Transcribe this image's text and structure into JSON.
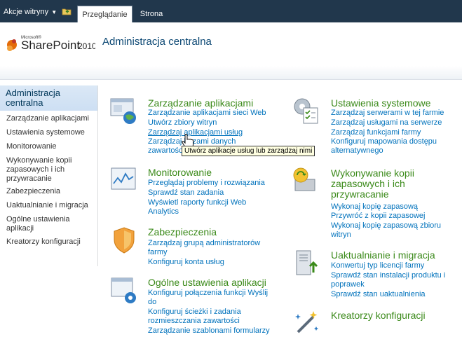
{
  "ribbon": {
    "site_actions": "Akcje witryny",
    "tabs": [
      {
        "label": "Przeglądanie"
      },
      {
        "label": "Strona"
      }
    ]
  },
  "header": {
    "logo_small": "Microsoft®",
    "logo_main": "SharePoint",
    "logo_year": "2010",
    "site_title": "Administracja centralna"
  },
  "leftnav": {
    "header": "Administracja centralna",
    "items": [
      "Zarządzanie aplikacjami",
      "Ustawienia systemowe",
      "Monitorowanie",
      "Wykonywanie kopii zapasowych i ich przywracanie",
      "Zabezpieczenia",
      "Uaktualnianie i migracja",
      "Ogólne ustawienia aplikacji",
      "Kreatorzy konfiguracji"
    ]
  },
  "sections": {
    "app_mgmt": {
      "title": "Zarządzanie aplikacjami",
      "links": [
        "Zarządzanie aplikacjami sieci Web",
        "Utwórz zbiory witryn",
        "Zarządzaj aplikacjami usług",
        "Zarządzaj bazami danych",
        "zawartości"
      ]
    },
    "system": {
      "title": "Ustawienia systemowe",
      "links": [
        "Zarządzaj serwerami w tej farmie",
        "Zarządzaj usługami na serwerze",
        "Zarządzaj funkcjami farmy",
        "Konfiguruj mapowania dostępu",
        "alternatywnego"
      ]
    },
    "monitoring": {
      "title": "Monitorowanie",
      "links": [
        "Przeglądaj problemy i rozwiązania",
        "Sprawdź stan zadania",
        "Wyświetl raporty funkcji Web",
        "Analytics"
      ]
    },
    "backup": {
      "title_lines": [
        "Wykonywanie kopii",
        "zapasowych i ich",
        "przywracanie"
      ],
      "links": [
        "Wykonaj kopię zapasową",
        "Przywróć z kopii zapasowej",
        "Wykonaj kopię zapasową zbioru",
        "witryn"
      ]
    },
    "security": {
      "title": "Zabezpieczenia",
      "links": [
        "Zarządzaj grupą administratorów",
        "farmy",
        "Konfiguruj konta usług"
      ]
    },
    "upgrade": {
      "title": "Uaktualnianie i migracja",
      "links": [
        "Konwertuj typ licencji farmy",
        "Sprawdź stan instalacji produktu i",
        "poprawek",
        "Sprawdź stan uaktualnienia"
      ]
    },
    "general": {
      "title": "Ogólne ustawienia aplikacji",
      "links": [
        "Konfiguruj połączenia funkcji Wyślij",
        "do",
        "Konfiguruj ścieżki i zadania",
        "rozmieszczania zawartości",
        "Zarządzanie szablonami formularzy"
      ]
    },
    "wizards": {
      "title": "Kreatorzy konfiguracji"
    }
  },
  "tooltip": "Utwórz aplikacje usług lub zarządzaj nimi"
}
